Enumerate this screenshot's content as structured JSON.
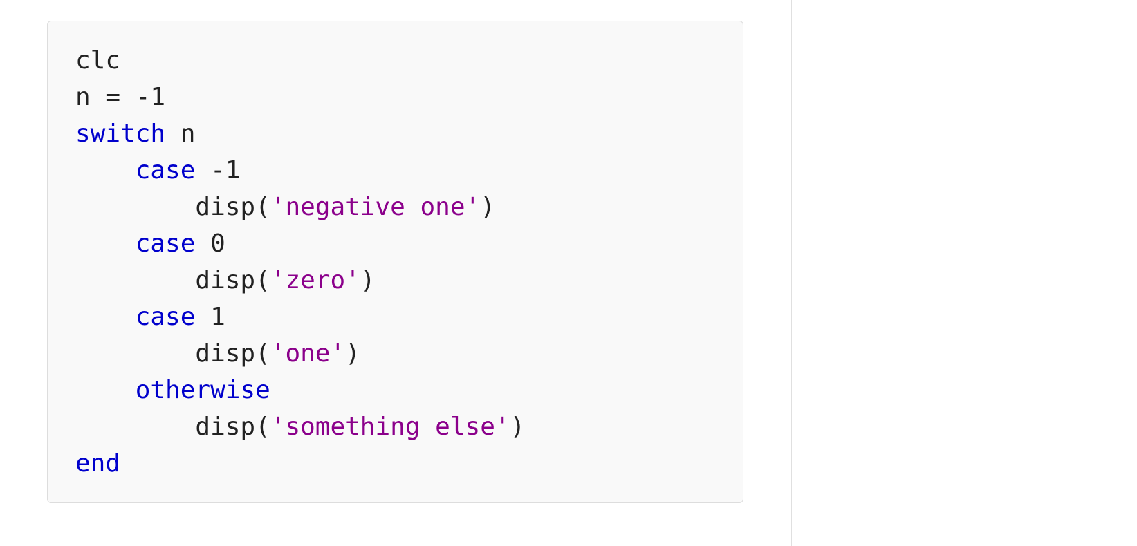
{
  "code": {
    "line1": "clc",
    "line2_pre": "n = -",
    "line2_num": "1",
    "line3_kw": "switch",
    "line3_rest": " n",
    "line4_pre": "    ",
    "line4_kw": "case",
    "line4_rest": " -1",
    "line5_pre": "        disp(",
    "line5_str": "'negative one'",
    "line5_post": ")",
    "line6_pre": "    ",
    "line6_kw": "case",
    "line6_rest": " 0",
    "line7_pre": "        disp(",
    "line7_str": "'zero'",
    "line7_post": ")",
    "line8_pre": "    ",
    "line8_kw": "case",
    "line8_rest": " 1",
    "line9_pre": "        disp(",
    "line9_str": "'one'",
    "line9_post": ")",
    "line10_pre": "    ",
    "line10_kw": "otherwise",
    "line11_pre": "        disp(",
    "line11_str": "'something else'",
    "line11_post": ")",
    "line12_kw": "end"
  }
}
